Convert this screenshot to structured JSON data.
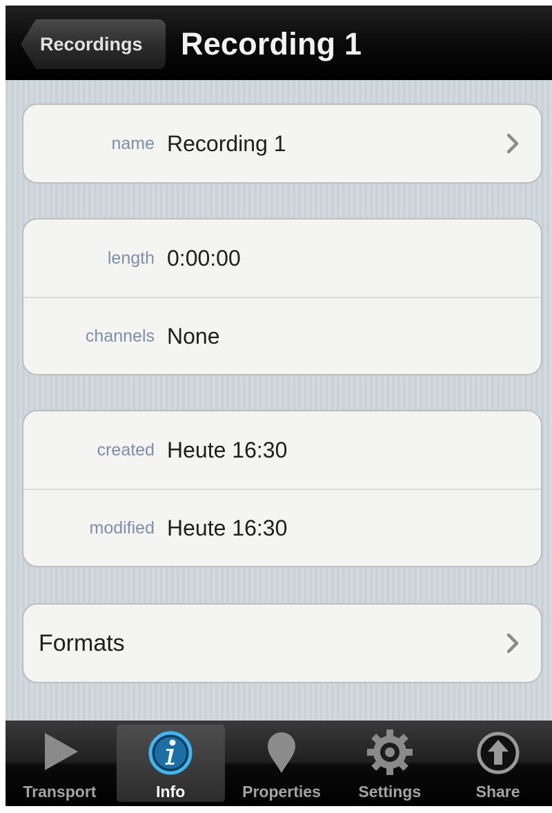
{
  "navbar": {
    "back_label": "Recordings",
    "title": "Recording 1"
  },
  "groups": {
    "name": {
      "label": "name",
      "value": "Recording 1"
    },
    "audio": {
      "length": {
        "label": "length",
        "value": "0:00:00"
      },
      "channels": {
        "label": "channels",
        "value": "None"
      }
    },
    "dates": {
      "created": {
        "label": "created",
        "value": "Heute 16:30"
      },
      "modified": {
        "label": "modified",
        "value": "Heute 16:30"
      }
    },
    "formats": {
      "label": "Formats"
    }
  },
  "tabbar": {
    "selected": "Info",
    "tabs": [
      {
        "label": "Transport",
        "icon": "play-icon"
      },
      {
        "label": "Info",
        "icon": "info-icon"
      },
      {
        "label": "Properties",
        "icon": "pin-icon"
      },
      {
        "label": "Settings",
        "icon": "gear-icon"
      },
      {
        "label": "Share",
        "icon": "upload-icon"
      }
    ]
  },
  "colors": {
    "label_text": "#7d8fae",
    "value_text": "#1e1e1e",
    "navbar": "#000000",
    "info_accent": "#29a8e8",
    "table_background": "#cfd7dd"
  }
}
